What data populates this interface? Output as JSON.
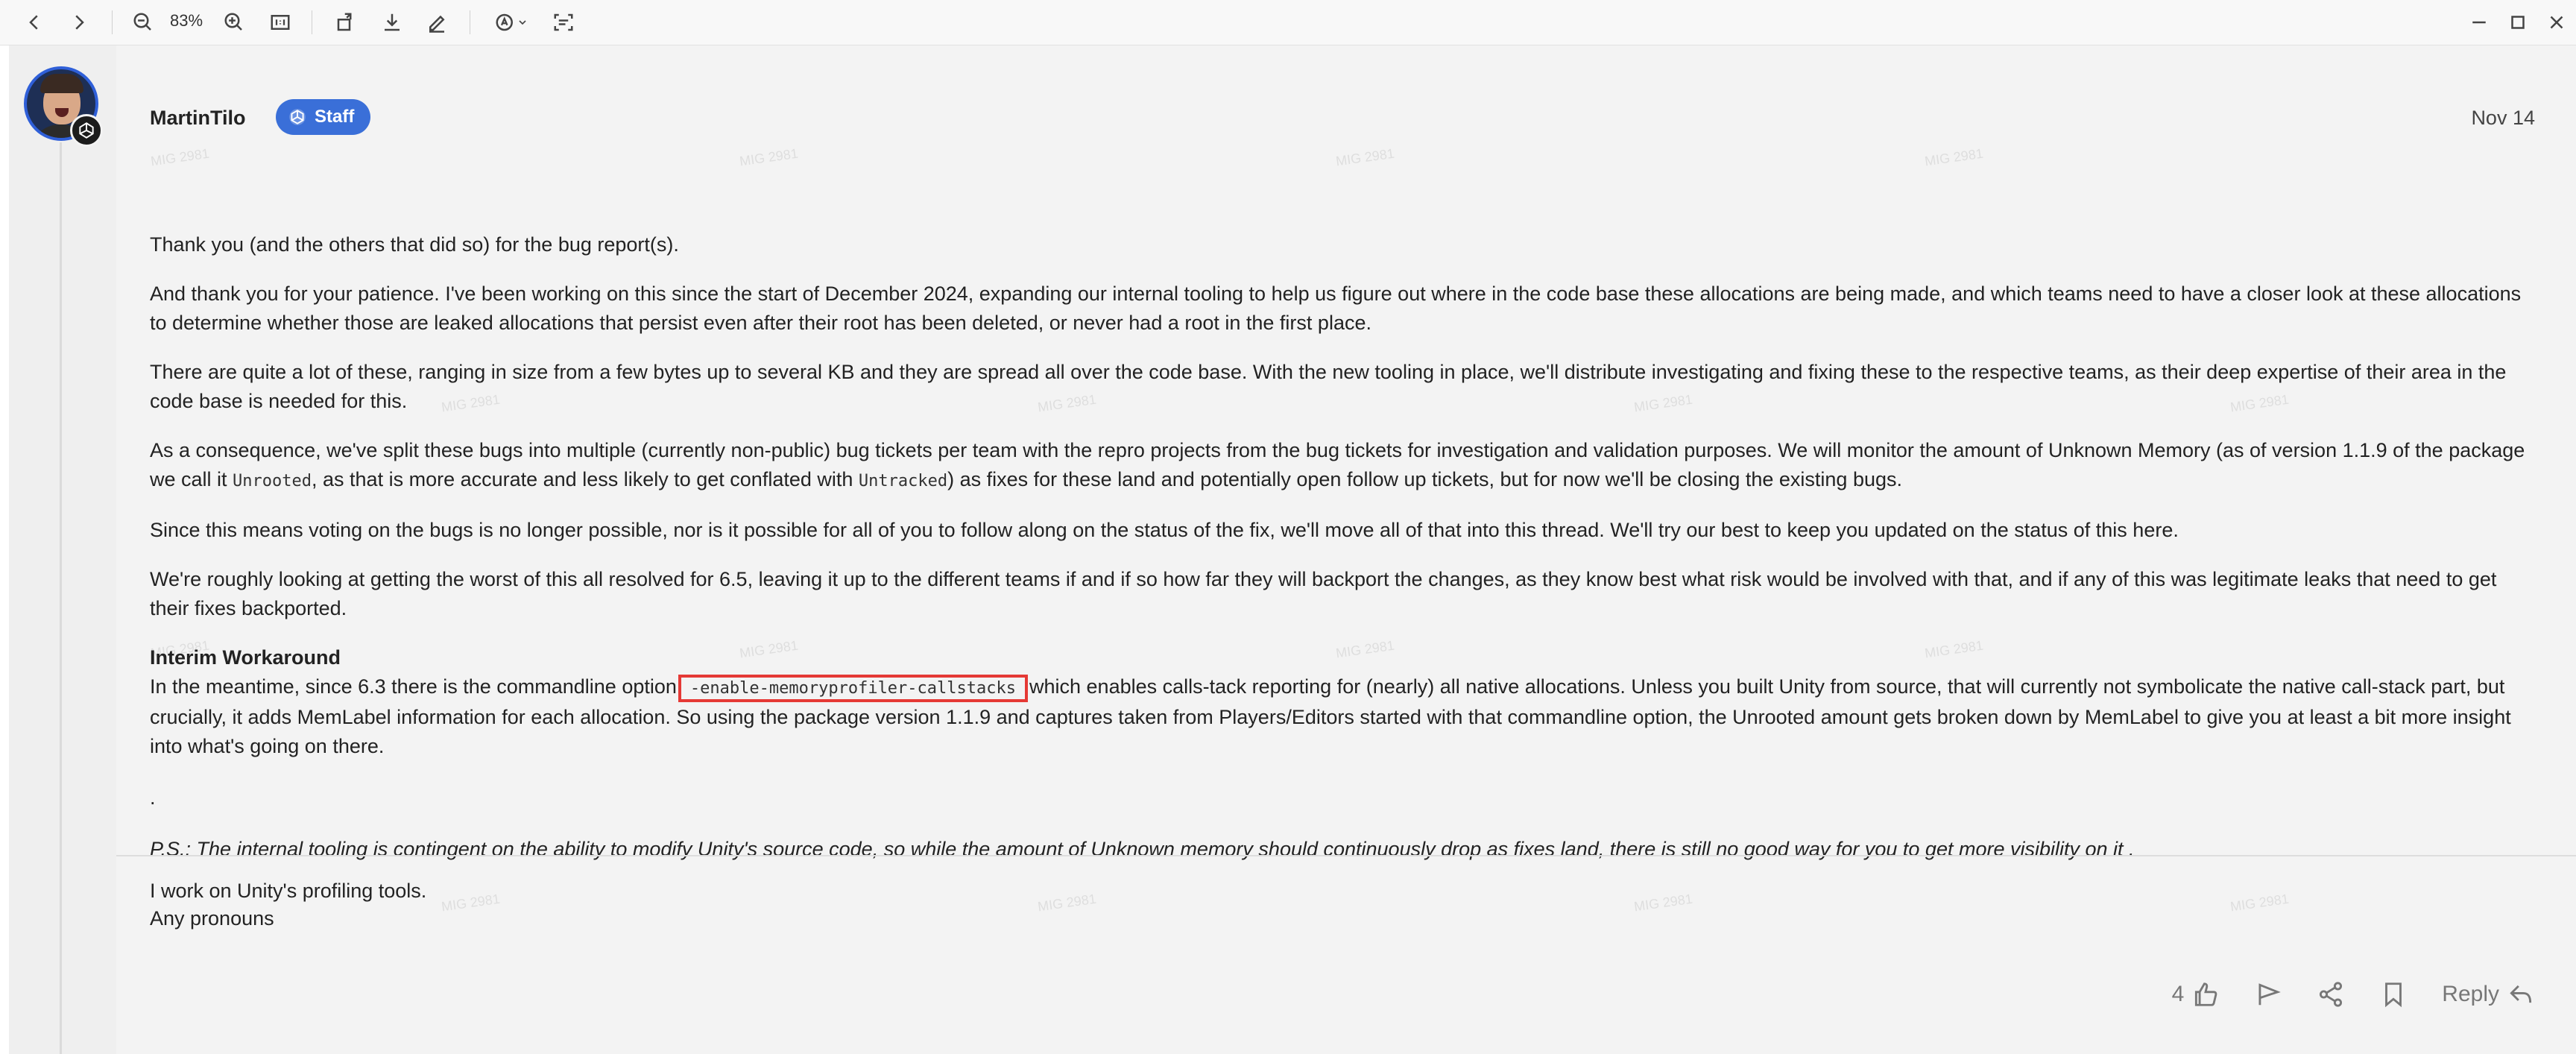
{
  "viewer": {
    "zoom": "83%"
  },
  "post": {
    "author": "MartinTilo",
    "badge": "Staff",
    "date": "Nov 14",
    "p1": "Thank you (and the others that did so) for the bug report(s).",
    "p2": "And thank you for your patience. I've been working on this since the start of December 2024, expanding our internal tooling to help us figure out where in the code base these allocations are being made, and which teams need to have a closer look at these allocations to determine whether those are leaked allocations that persist even after their root has been deleted, or never had a root in the first place.",
    "p3": "There are quite a lot of these, ranging in size from a few bytes up to several KB and they are spread all over the code base. With the new tooling in place, we'll distribute investigating and fixing these to the respective teams, as their deep expertise of their area in the code base is needed for this.",
    "p4_a": "As a consequence, we've split these bugs into multiple (currently non-public) bug tickets per team with the repro projects from the bug tickets for investigation and validation purposes. We will monitor the amount of Unknown Memory (as of version 1.1.9 of the package we call it ",
    "p4_code1": "Unrooted",
    "p4_b": ", as that is more accurate and less likely to get conflated with ",
    "p4_code2": "Untracked",
    "p4_c": ") as fixes for these land and potentially open follow up tickets, but for now we'll be closing the existing bugs.",
    "p5": "Since this means voting on the bugs is no longer possible, nor is it possible for all of you to follow along on the status of the fix, we'll move all of that into this thread. We'll try our best to keep you updated on the status of this here.",
    "p6": "We're roughly looking at getting the worst of this all resolved for 6.5, leaving it up to the different teams if and if so how far they will backport the changes, as they know best what risk would be involved with that, and if any of this was legitimate leaks that need to get their fixes backported.",
    "workaround_title": "Interim Workaround",
    "p7_a": "In the meantime, since 6.3 there is the commandline option",
    "p7_cmd": "-enable-memoryprofiler-callstacks",
    "p7_b": "which enables calls-tack reporting for (nearly) all native allocations. Unless you built Unity from source, that will currently not symbolicate the native call-stack part, but crucially, it adds MemLabel information for each allocation. So using the package version 1.1.9 and captures taken from Players/Editors started with that commandline option, the Unrooted amount gets broken down by MemLabel to give you at least a bit more insight into what's going on there.",
    "dot": ".",
    "ps": "P.S.: The internal tooling is contingent on the ability to modify Unity's source code, so while the amount of Unknown memory should continuously drop as fixes land, there is still no good way for you to get more visibility on it ."
  },
  "signature": {
    "line1": "I work on Unity's profiling tools.",
    "line2": "Any pronouns"
  },
  "actions": {
    "like_count": "4",
    "reply_label": "Reply"
  },
  "watermark": {
    "text": "MIG 2981"
  },
  "colors": {
    "accent": "#3a6fd8",
    "highlight_box": "#e53935",
    "page_bg": "#f3f3f3"
  }
}
